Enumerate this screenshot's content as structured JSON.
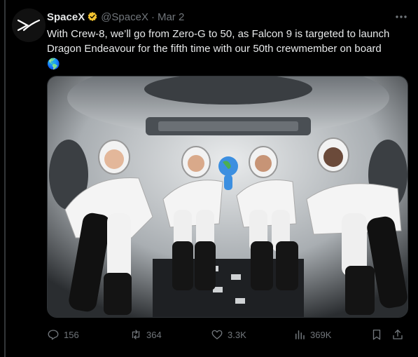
{
  "tweet": {
    "author_name": "SpaceX",
    "handle": "@SpaceX",
    "separator": "·",
    "date": "Mar 2",
    "text": "With Crew-8, we’ll go from Zero-G to 50, as Falcon 9 is targeted to launch Dragon Endeavour for the fifth time with our 50th crewmember on board",
    "emoji": "🌎"
  },
  "actions": {
    "replies": "156",
    "reposts": "364",
    "likes": "3.3K",
    "views": "369K"
  },
  "icons": {
    "avatar": "spacex-logo-icon",
    "verified": "verified-badge-icon",
    "more": "more-icon",
    "reply": "reply-icon",
    "repost": "repost-icon",
    "like": "heart-icon",
    "views": "views-icon",
    "bookmark": "bookmark-icon",
    "share": "share-icon"
  },
  "colors": {
    "background": "#000000",
    "text": "#e7e9ea",
    "muted": "#71767b",
    "verified": "#f4c430"
  }
}
